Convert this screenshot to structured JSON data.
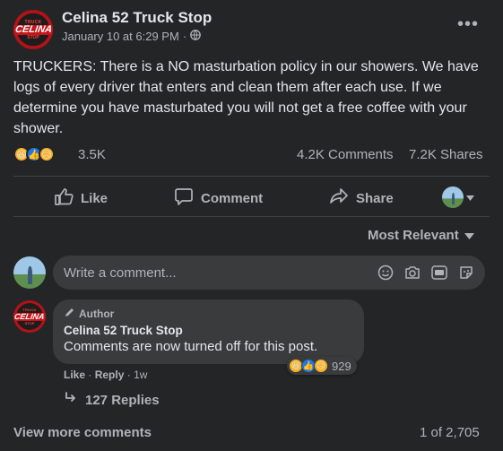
{
  "post": {
    "page_name": "Celina 52 Truck Stop",
    "date": "January 10 at 6:29 PM",
    "separator": "·",
    "more_label": "•••",
    "logo": {
      "top": "TRUCK",
      "mid": "CELINA",
      "bottom": "STOP"
    },
    "text": "TRUCKERS: There is a NO masturbation policy in our showers. We have logs of every driver that enters and clean them after each use. If we determine you have masturbated you will not get a free coffee with your shower."
  },
  "stats": {
    "reactions_count": "3.5K",
    "reactions": [
      "haha-icon",
      "like-icon",
      "sad-icon"
    ],
    "comments": "4.2K Comments",
    "shares": "7.2K Shares"
  },
  "actions": {
    "like": "Like",
    "comment": "Comment",
    "share": "Share"
  },
  "comments": {
    "sort_label": "Most Relevant",
    "input_placeholder": "Write a comment...",
    "items": [
      {
        "badge": "Author",
        "name": "Celina 52 Truck Stop",
        "text": "Comments are now turned off for this post.",
        "reaction_count": "929",
        "like": "Like",
        "reply": "Reply",
        "age": "1w",
        "replies": "127 Replies"
      }
    ],
    "view_more": "View more comments",
    "paging": "1 of 2,705"
  },
  "colors": {
    "background": "#242526",
    "bubble": "#3a3b3c",
    "text": "#e4e6eb",
    "muted": "#b0b3b8",
    "like_blue": "#1877f2",
    "reaction_yellow": "#f7b125"
  }
}
